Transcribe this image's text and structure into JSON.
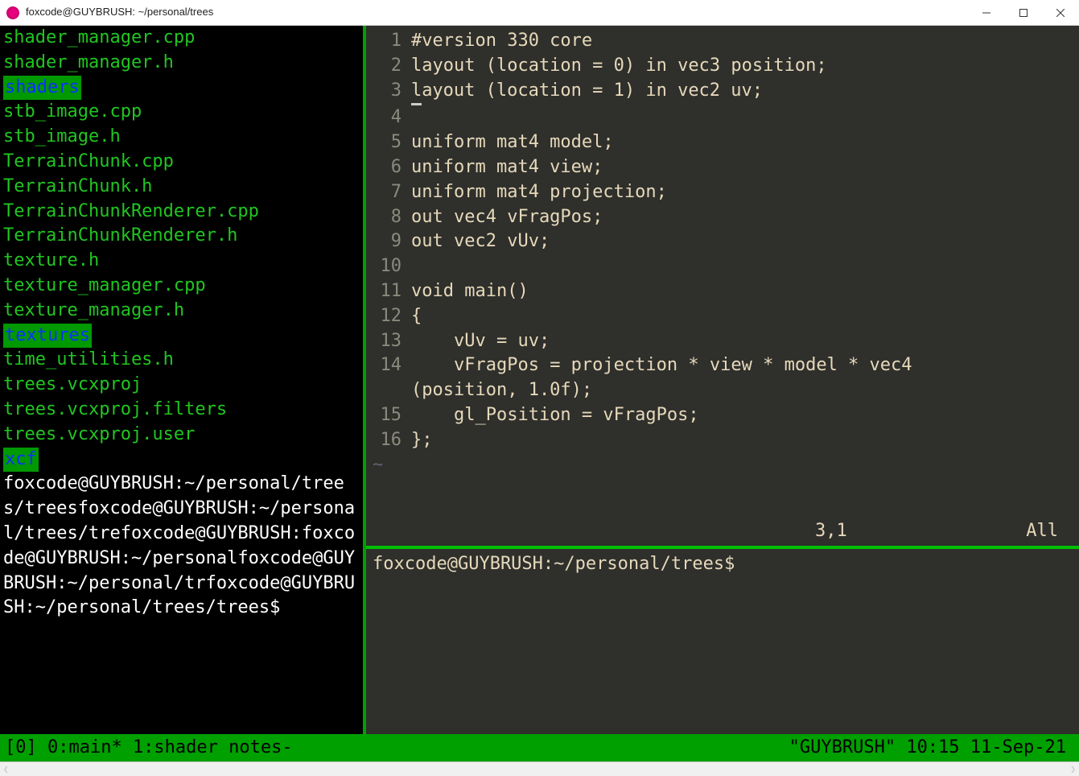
{
  "window": {
    "title": "foxcode@GUYBRUSH: ~/personal/trees"
  },
  "left_pane": {
    "files": [
      {
        "name": "shader_manager.cpp",
        "type": "file"
      },
      {
        "name": "shader_manager.h",
        "type": "file"
      },
      {
        "name": "shaders",
        "type": "dir"
      },
      {
        "name": "stb_image.cpp",
        "type": "file"
      },
      {
        "name": "stb_image.h",
        "type": "file"
      },
      {
        "name": "TerrainChunk.cpp",
        "type": "file"
      },
      {
        "name": "TerrainChunk.h",
        "type": "file"
      },
      {
        "name": "TerrainChunkRenderer.cpp",
        "type": "file"
      },
      {
        "name": "TerrainChunkRenderer.h",
        "type": "file"
      },
      {
        "name": "texture.h",
        "type": "file"
      },
      {
        "name": "texture_manager.cpp",
        "type": "file"
      },
      {
        "name": "texture_manager.h",
        "type": "file"
      },
      {
        "name": "textures",
        "type": "dir"
      },
      {
        "name": "time_utilities.h",
        "type": "file"
      },
      {
        "name": "trees.vcxproj",
        "type": "file"
      },
      {
        "name": "trees.vcxproj.filters",
        "type": "file"
      },
      {
        "name": "trees.vcxproj.user",
        "type": "file"
      },
      {
        "name": "xcf",
        "type": "dir"
      }
    ],
    "prompt_wrapped": "foxcode@GUYBRUSH:~/personal/trees/treesfoxcode@GUYBRUSH:~/personal/trees/trefoxcode@GUYBRUSH:foxcode@GUYBRUSH:~/personalfoxcode@GUYBRUSH:~/personal/trfoxcode@GUYBRUSH:~/personal/trees/trees$"
  },
  "editor": {
    "lines": [
      {
        "n": "1",
        "t": "#version 330 core"
      },
      {
        "n": "2",
        "t": "layout (location = 0) in vec3 position;"
      },
      {
        "n": "3",
        "t": "layout (location = 1) in vec2 uv;"
      },
      {
        "n": "4",
        "t": ""
      },
      {
        "n": "5",
        "t": "uniform mat4 model;"
      },
      {
        "n": "6",
        "t": "uniform mat4 view;"
      },
      {
        "n": "7",
        "t": "uniform mat4 projection;"
      },
      {
        "n": "8",
        "t": "out vec4 vFragPos;"
      },
      {
        "n": "9",
        "t": "out vec2 vUv;"
      },
      {
        "n": "10",
        "t": ""
      },
      {
        "n": "11",
        "t": "void main()"
      },
      {
        "n": "12",
        "t": "{"
      },
      {
        "n": "13",
        "t": "    vUv = uv;"
      },
      {
        "n": "14",
        "t": "    vFragPos = projection * view * model * vec4(position, 1.0f);"
      },
      {
        "n": "15",
        "t": "    gl_Position = vFragPos;"
      },
      {
        "n": "16",
        "t": "};"
      }
    ],
    "tilde": "~",
    "status": {
      "pos": "3,1",
      "pct": "All"
    }
  },
  "shell": {
    "prompt": "foxcode@GUYBRUSH:~/personal/trees$"
  },
  "tmux": {
    "left": "[0] 0:main* 1:shader notes-",
    "right": "\"GUYBRUSH\" 10:15 11-Sep-21"
  }
}
